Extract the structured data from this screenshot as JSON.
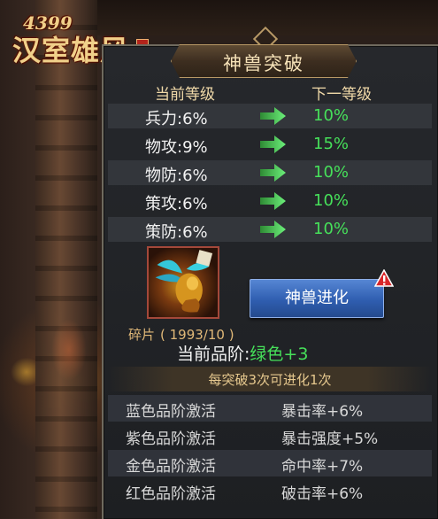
{
  "logo": {
    "number": "4399",
    "name": "汉室雄风"
  },
  "panel": {
    "title": "神兽突破"
  },
  "headers": {
    "current": "当前等级",
    "next": "下一等级"
  },
  "stats": [
    {
      "label": "兵力:6%",
      "next": "10%"
    },
    {
      "label": "物攻:9%",
      "next": "15%"
    },
    {
      "label": "物防:6%",
      "next": "10%"
    },
    {
      "label": "策攻:6%",
      "next": "10%"
    },
    {
      "label": "策防:6%",
      "next": "10%"
    }
  ],
  "shard": {
    "label": "碎片",
    "count": "( 1993/10 )"
  },
  "evolve_button": "神兽进化",
  "grade": {
    "label": "当前品阶:",
    "value": "绿色+3"
  },
  "rule": "每突破3次可进化1次",
  "activations": [
    {
      "name": "蓝色品阶激活",
      "effect": "暴击率+6%"
    },
    {
      "name": "紫色品阶激活",
      "effect": "暴击强度+5%"
    },
    {
      "name": "金色品阶激活",
      "effect": "命中率+7%"
    },
    {
      "name": "红色品阶激活",
      "effect": "破击率+6%"
    }
  ],
  "colors": {
    "upgrade_green": "#46e05a",
    "gold_text": "#f0d9a8",
    "button_blue": "#2f5eb0",
    "alert_red": "#d8262a"
  },
  "icons": {
    "arrow": "green-arrow-right-icon",
    "alert": "exclamation-alert-icon",
    "ornament": "diamond-ornament-icon"
  }
}
